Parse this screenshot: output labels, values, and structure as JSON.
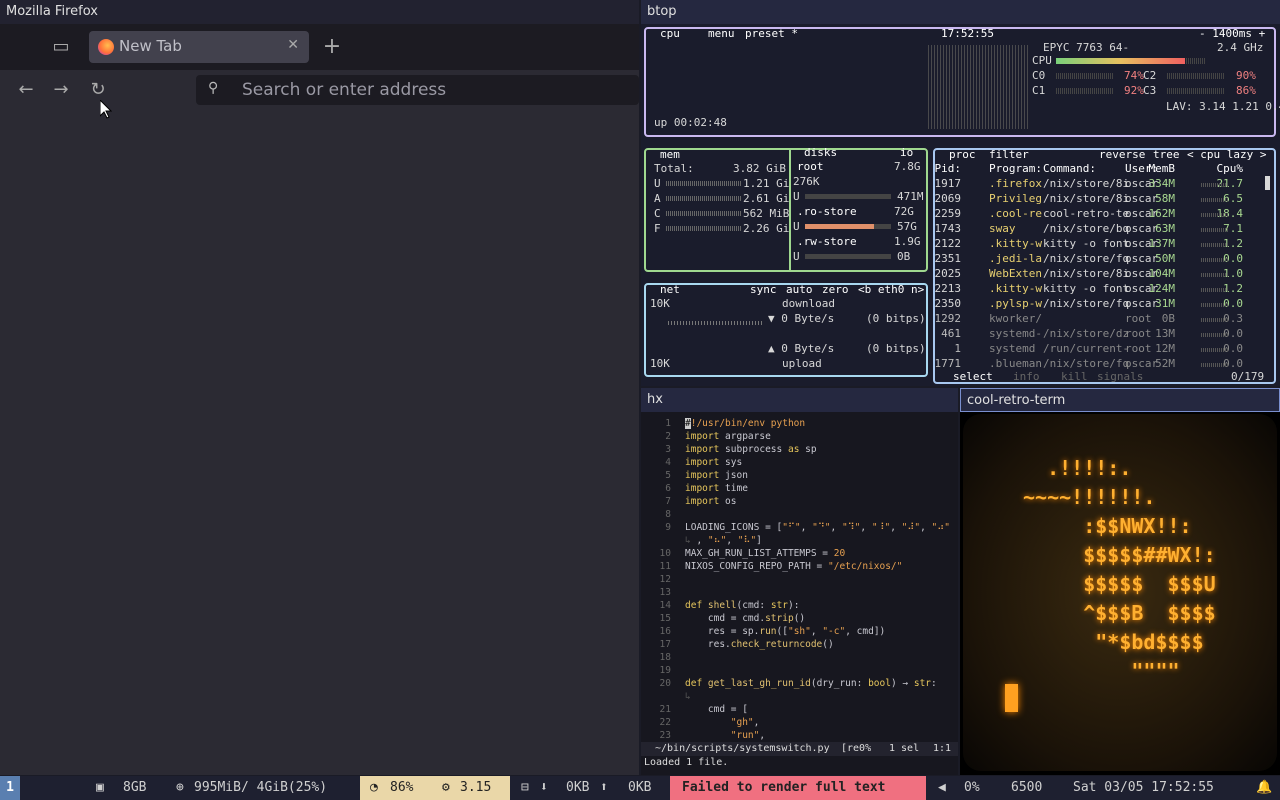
{
  "firefox": {
    "window_title": "Mozilla Firefox",
    "tab_title": "New Tab",
    "url_placeholder": "Search or enter address"
  },
  "btop": {
    "window_title": "btop",
    "cpu": {
      "hdr_cpu": "cpu",
      "hdr_menu": "menu",
      "hdr_preset": "preset *",
      "clock": "17:52:55",
      "interval": "- 1400ms +",
      "model": "EPYC 7763 64-",
      "freq": "2.4 GHz",
      "rows": [
        {
          "label": "CPU",
          "pct": "86%",
          "fill": 0.86
        },
        {
          "label": "C0",
          "pct": "74%",
          "fill": 0.74
        },
        {
          "label": "C2",
          "pct": "90%",
          "fill": 0.9
        },
        {
          "label": "C1",
          "pct": "92%",
          "fill": 0.92
        },
        {
          "label": "C3",
          "pct": "86%",
          "fill": 0.86
        }
      ],
      "lav": "LAV: 3.14 1.21 0.46",
      "uptime": "up 00:02:48"
    },
    "mem": {
      "hdr": "mem",
      "total_label": "Total:",
      "total": "3.82 GiB",
      "rows": [
        {
          "k": "U",
          "v": "1.21 Gi"
        },
        {
          "k": "A",
          "v": "2.61 Gi"
        },
        {
          "k": "C",
          "v": "562 MiB"
        },
        {
          "k": "F",
          "v": "2.26 Gi"
        }
      ]
    },
    "disks": {
      "hdr": "disks",
      "io": "io",
      "items": [
        {
          "name": "root",
          "size": "7.8G",
          "sub": "276K",
          "u": "U",
          "used": "471M"
        },
        {
          "name": ".ro-store",
          "size": "72G",
          "u": "U",
          "used": "57G"
        },
        {
          "name": ".rw-store",
          "size": "1.9G",
          "u": "U",
          "used": "0B"
        }
      ]
    },
    "net": {
      "hdr": "net",
      "sync": "sync",
      "auto": "auto",
      "zero": "zero",
      "iface": "<b eth0 n>",
      "top": "10K",
      "bottom": "10K",
      "download": "download",
      "down_rate": "▼ 0 Byte/s",
      "down_bits": "(0 bitps)",
      "up_rate": "▲ 0 Byte/s",
      "up_bits": "(0 bitps)",
      "upload": "upload"
    },
    "proc": {
      "hdr": "proc",
      "filter": "filter",
      "reverse": "reverse",
      "tree": "tree",
      "sort": "< cpu lazy >",
      "cols": [
        "Pid:",
        "Program:",
        "Command:",
        "User:",
        "MemB",
        "Cpu%"
      ],
      "rows": [
        [
          "1917",
          ".firefox",
          "/nix/store/8i",
          "oscar",
          "334M",
          "21.7"
        ],
        [
          "2069",
          "Privileg",
          "/nix/store/8i",
          "oscar",
          "58M",
          "6.5"
        ],
        [
          "2259",
          ".cool-re",
          "cool-retro-te",
          "oscar",
          "162M",
          "18.4"
        ],
        [
          "1743",
          "sway",
          "/nix/store/bq",
          "oscar",
          "63M",
          "7.1"
        ],
        [
          "2122",
          ".kitty-w",
          "kitty -o font",
          "oscar",
          "137M",
          "1.2"
        ],
        [
          "2351",
          ".jedi-la",
          "/nix/store/fq",
          "oscar",
          "50M",
          "0.0"
        ],
        [
          "2025",
          "WebExten",
          "/nix/store/8i",
          "oscar",
          "104M",
          "1.0"
        ],
        [
          "2213",
          ".kitty-w",
          "kitty -o font",
          "oscar",
          "124M",
          "1.2"
        ],
        [
          "2350",
          ".pylsp-w",
          "/nix/store/fq",
          "oscar",
          "31M",
          "0.0"
        ],
        [
          "1292",
          "kworker/",
          "",
          "root",
          "0B",
          "0.3"
        ],
        [
          "461",
          "systemd-",
          "/nix/store/dz",
          "root",
          "13M",
          "0.0"
        ],
        [
          "1",
          "systemd",
          "/run/current-",
          "root",
          "12M",
          "0.0"
        ],
        [
          "1771",
          ".blueman",
          "/nix/store/fq",
          "oscar",
          "52M",
          "0.0"
        ]
      ],
      "footer_select": "select",
      "footer_info": "info",
      "footer_kill": "kill",
      "footer_signals": "signals",
      "count": "0/179"
    }
  },
  "hx": {
    "window_title": "hx",
    "status_path": "~/bin/scripts/systemswitch.py",
    "status_mid": "[re0%",
    "status_sel": "1 sel",
    "status_pos": "1:1",
    "message": "Loaded 1 file."
  },
  "crt": {
    "window_title": "cool-retro-term",
    "art": "  .!!!!:.\n~~~~!!!!!!.\n     :$$NWX!!:\n     $$$$$##WX!:\n     $$$$$  $$$U\n     ^$$$B  $$$$\n      \"*$bd$$$$\n         \"\"\"\""
  },
  "bar": {
    "workspace": "1",
    "ram": "8GB",
    "swap": "995MiB/ 4GiB(25%)",
    "cpu": "86%",
    "load": "3.15",
    "disk_down": "0KB",
    "disk_up": "0KB",
    "error": "Failed to render full text",
    "volume": "0%",
    "temp": "6500",
    "datetime": "Sat 03/05 17:52:55"
  }
}
